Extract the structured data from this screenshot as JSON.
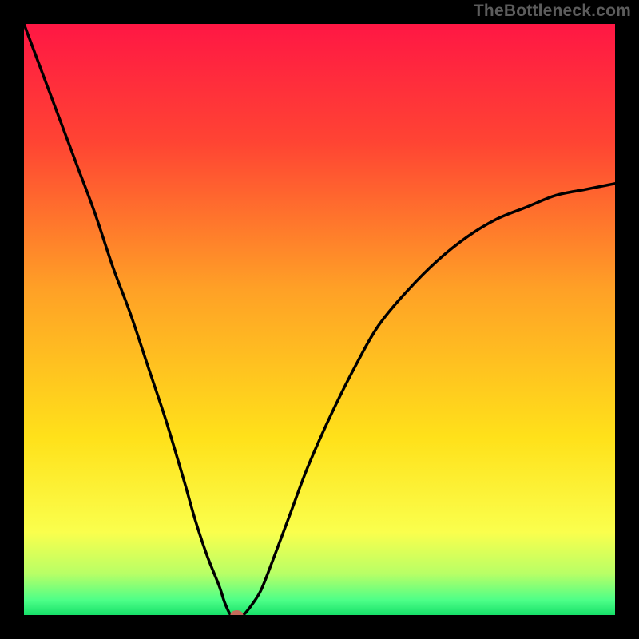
{
  "attribution": "TheBottleneck.com",
  "chart_data": {
    "type": "line",
    "title": "",
    "xlabel": "",
    "ylabel": "",
    "xlim": [
      0,
      100
    ],
    "ylim": [
      0,
      100
    ],
    "x": [
      0,
      3,
      6,
      9,
      12,
      15,
      18,
      21,
      24,
      27,
      29,
      31,
      33,
      34,
      35,
      36,
      37,
      38,
      40,
      42,
      45,
      48,
      52,
      56,
      60,
      65,
      70,
      75,
      80,
      85,
      90,
      95,
      100
    ],
    "values": [
      100,
      92,
      84,
      76,
      68,
      59,
      51,
      42,
      33,
      23,
      16,
      10,
      5,
      2,
      0,
      0,
      0,
      1,
      4,
      9,
      17,
      25,
      34,
      42,
      49,
      55,
      60,
      64,
      67,
      69,
      71,
      72,
      73
    ],
    "marker": {
      "x": 36,
      "y": 0
    },
    "background_gradient": {
      "stops": [
        {
          "offset": 0.0,
          "color": "#ff1744"
        },
        {
          "offset": 0.2,
          "color": "#ff4433"
        },
        {
          "offset": 0.45,
          "color": "#ffa126"
        },
        {
          "offset": 0.7,
          "color": "#ffe11a"
        },
        {
          "offset": 0.86,
          "color": "#faff4d"
        },
        {
          "offset": 0.93,
          "color": "#b8ff66"
        },
        {
          "offset": 0.975,
          "color": "#4dff88"
        },
        {
          "offset": 1.0,
          "color": "#17e069"
        }
      ]
    },
    "curve_color": "#000000",
    "marker_color": "#c46a5a"
  }
}
